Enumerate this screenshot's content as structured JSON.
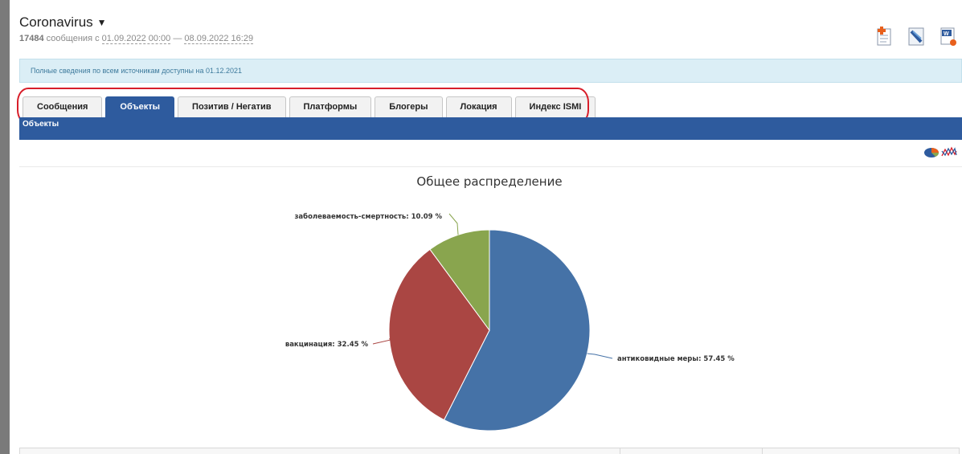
{
  "header": {
    "title": "Coronavirus",
    "count": "17484",
    "count_suffix": " сообщения с ",
    "date_from": "01.09.2022 00:00",
    "date_sep": " — ",
    "date_to": "08.09.2022 16:29"
  },
  "toolbar": {
    "icons": [
      "add-document-icon",
      "rss-feed-icon",
      "word-export-icon"
    ]
  },
  "notice": "Полные сведения по всем источникам доступны на 01.12.2021",
  "tabs": [
    {
      "label": "Сообщения",
      "active": false
    },
    {
      "label": "Объекты",
      "active": true
    },
    {
      "label": "Позитив / Негатив",
      "active": false
    },
    {
      "label": "Платформы",
      "active": false
    },
    {
      "label": "Блогеры",
      "active": false
    },
    {
      "label": "Локация",
      "active": false
    },
    {
      "label": "Индекс ISMI",
      "active": false
    }
  ],
  "section_title": "Объекты",
  "view_icons": [
    "pie-chart-view-icon",
    "line-chart-view-icon"
  ],
  "chart_data": {
    "type": "pie",
    "title": "Общее распределение",
    "slices": [
      {
        "label": "антиковидные меры",
        "value": 57.45,
        "display": "антиковидные меры: 57.45 %",
        "color": "#4572a7"
      },
      {
        "label": "вакцинация",
        "value": 32.45,
        "display": "вакцинация: 32.45 %",
        "color": "#aa4643"
      },
      {
        "label": "заболеваемость-смертность",
        "value": 10.09,
        "display": "заболеваемость-смертность: 10.09 %",
        "color": "#89a54e"
      }
    ]
  },
  "colors": {
    "accent": "#2e5b9e",
    "highlight": "#d81e2a",
    "notice_bg": "#dbeef6"
  }
}
